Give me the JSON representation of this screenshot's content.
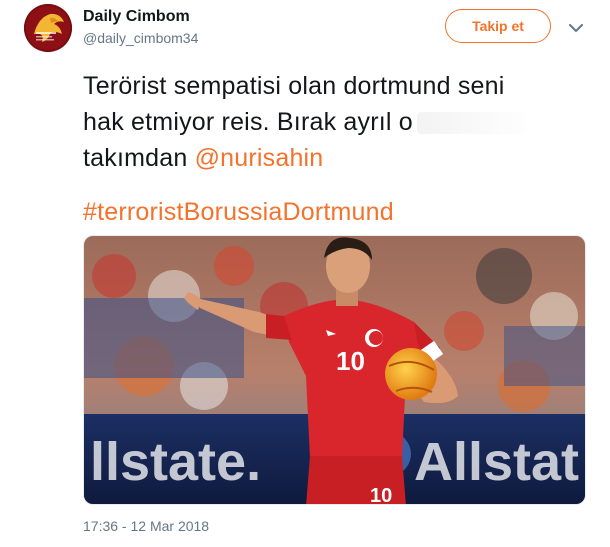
{
  "user": {
    "name": "Daily Cimbom",
    "handle": "@daily_cimbom34"
  },
  "follow_button": {
    "label": "Takip et"
  },
  "tweet": {
    "line1": "Terörist sempatisi olan dortmund seni",
    "line2": "hak etmiyor reis. Bırak ayrıl o",
    "line3_text": "takımdan ",
    "mention": "@nurisahin",
    "hashtag": "#terroristBorussiaDortmund"
  },
  "media": {
    "jersey_number": "10",
    "shorts_number": "10",
    "ad_text_left": "llstate.",
    "ad_text_right": "Allstat"
  },
  "timestamp": "17:36 - 12 Mar 2018",
  "colors": {
    "accent": "#f4722b",
    "text": "#14171a",
    "muted": "#657786",
    "jersey": "#d8262c"
  },
  "icons": {
    "caret": "chevron-down-icon",
    "avatar": "galatasaray-lion-logo"
  }
}
